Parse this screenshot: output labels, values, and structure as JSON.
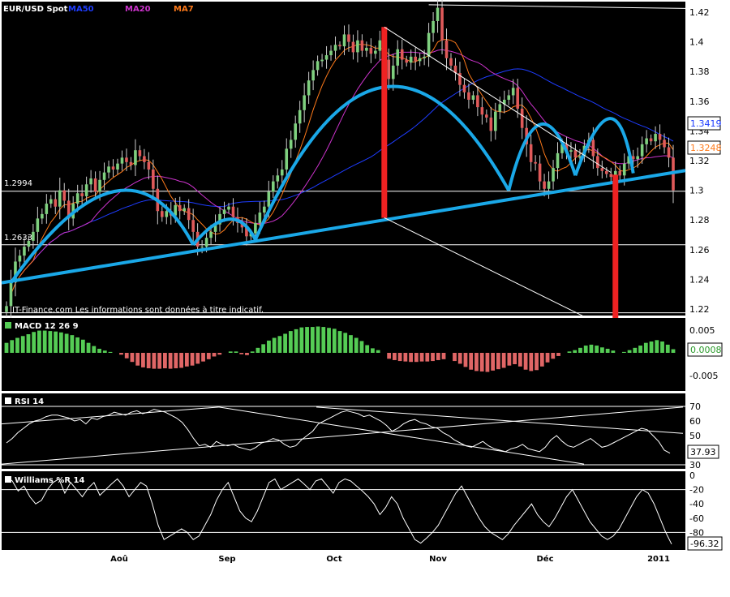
{
  "main_panel": {
    "legend": {
      "symbol": "EUR/USD Spot",
      "ma50": "MA50",
      "ma20": "MA20",
      "ma7": "MA7"
    },
    "disclaimer": "IT-Finance.com Les informations sont données à titre indicatif.",
    "level_labels": [
      "1.2994",
      "1.2633"
    ],
    "last_values": {
      "ma50": "1.3419",
      "ma7": "1.3248"
    }
  },
  "macd_panel": {
    "title": "MACD 12 26 9",
    "last_value": "0.0008"
  },
  "rsi_panel": {
    "title": "RSI 14",
    "last_value": "37.93"
  },
  "williams_panel": {
    "title": "Williams %R 14",
    "last_value": "-96.32"
  },
  "colors": {
    "background": "#000000",
    "bull_candle": "#7fd07f",
    "bear_candle": "#e05a5a",
    "ma50": "#1e3cff",
    "ma20": "#cc33cc",
    "ma7": "#ff7a1a",
    "pattern": "#1aa8e8",
    "target": "#ee2222",
    "macd_pos": "#55cc55",
    "macd_neg": "#e06666"
  },
  "chart_data": [
    {
      "type": "candlestick",
      "title": "EUR/USD Spot",
      "series": [
        {
          "name": "MA50",
          "color": "#1e3cff"
        },
        {
          "name": "MA20",
          "color": "#cc33cc"
        },
        {
          "name": "MA7",
          "color": "#ff7a1a"
        }
      ],
      "x_ticks": [
        "Aoû",
        "Sep",
        "Oct",
        "Nov",
        "Déc",
        "2011"
      ],
      "y_ticks": [
        1.22,
        1.24,
        1.26,
        1.28,
        1.3,
        1.32,
        1.34,
        1.36,
        1.38,
        1.4,
        1.42
      ],
      "ylim": [
        1.21,
        1.425
      ],
      "close": [
        1.222,
        1.238,
        1.252,
        1.256,
        1.262,
        1.266,
        1.272,
        1.281,
        1.284,
        1.291,
        1.294,
        1.289,
        1.3,
        1.293,
        1.281,
        1.291,
        1.298,
        1.296,
        1.304,
        1.308,
        1.299,
        1.307,
        1.312,
        1.316,
        1.314,
        1.318,
        1.322,
        1.319,
        1.317,
        1.327,
        1.323,
        1.319,
        1.314,
        1.301,
        1.286,
        1.282,
        1.286,
        1.283,
        1.29,
        1.286,
        1.288,
        1.28,
        1.272,
        1.262,
        1.262,
        1.268,
        1.272,
        1.277,
        1.284,
        1.287,
        1.289,
        1.282,
        1.278,
        1.275,
        1.269,
        1.271,
        1.278,
        1.285,
        1.289,
        1.299,
        1.306,
        1.31,
        1.314,
        1.328,
        1.334,
        1.345,
        1.354,
        1.364,
        1.374,
        1.381,
        1.387,
        1.388,
        1.391,
        1.394,
        1.398,
        1.397,
        1.405,
        1.4,
        1.393,
        1.401,
        1.394,
        1.396,
        1.392,
        1.394,
        1.401,
        1.388,
        1.375,
        1.384,
        1.395,
        1.388,
        1.386,
        1.39,
        1.387,
        1.389,
        1.39,
        1.406,
        1.414,
        1.423,
        1.401,
        1.389,
        1.384,
        1.379,
        1.371,
        1.366,
        1.361,
        1.364,
        1.356,
        1.351,
        1.349,
        1.34,
        1.353,
        1.358,
        1.361,
        1.364,
        1.369,
        1.355,
        1.342,
        1.331,
        1.319,
        1.318,
        1.306,
        1.301,
        1.306,
        1.315,
        1.325,
        1.331,
        1.326,
        1.327,
        1.322,
        1.323,
        1.33,
        1.334,
        1.323,
        1.315,
        1.313,
        1.311,
        1.309,
        1.313,
        1.31,
        1.318,
        1.323,
        1.321,
        1.323,
        1.331,
        1.335,
        1.333,
        1.338,
        1.334,
        1.329,
        1.322,
        1.3
      ],
      "ma50_last": 1.3419,
      "ma7_last": 1.3248,
      "annotations": [
        "1.2994",
        "1.2633"
      ]
    },
    {
      "type": "bar",
      "title": "MACD 12 26 9",
      "y_ticks": [
        0.005,
        -0.005
      ],
      "last_value": 0.0008,
      "values": [
        0.0022,
        0.0028,
        0.0033,
        0.0037,
        0.0041,
        0.0046,
        0.0049,
        0.0049,
        0.0048,
        0.0047,
        0.0045,
        0.0042,
        0.0039,
        0.0034,
        0.0029,
        0.0022,
        0.0015,
        0.0009,
        0.0005,
        0.0002,
        0.0,
        -0.0004,
        -0.0012,
        -0.002,
        -0.0028,
        -0.0032,
        -0.0034,
        -0.0035,
        -0.0035,
        -0.0034,
        -0.0035,
        -0.0034,
        -0.0033,
        -0.003,
        -0.0028,
        -0.0024,
        -0.0019,
        -0.0014,
        -0.0008,
        -0.0004,
        0.0,
        0.0003,
        0.0003,
        -0.0003,
        -0.0005,
        0.0003,
        0.0011,
        0.0019,
        0.0027,
        0.0033,
        0.0037,
        0.0042,
        0.0048,
        0.0052,
        0.0056,
        0.0057,
        0.0057,
        0.0058,
        0.0057,
        0.0055,
        0.0053,
        0.0048,
        0.0044,
        0.0039,
        0.0033,
        0.0026,
        0.0017,
        0.001,
        0.0006,
        0.0,
        -0.0013,
        -0.0016,
        -0.0018,
        -0.0019,
        -0.002,
        -0.002,
        -0.0019,
        -0.0019,
        -0.0018,
        -0.0016,
        -0.0014,
        0.0,
        -0.0018,
        -0.0024,
        -0.0031,
        -0.0037,
        -0.004,
        -0.0041,
        -0.0042,
        -0.0039,
        -0.0036,
        -0.0033,
        -0.0028,
        -0.0025,
        -0.003,
        -0.0037,
        -0.004,
        -0.0038,
        -0.003,
        -0.0021,
        -0.0013,
        -0.0007,
        0.0,
        0.0003,
        0.0006,
        0.0011,
        0.0016,
        0.0018,
        0.0016,
        0.0012,
        0.0009,
        0.0005,
        0.0,
        0.0002,
        0.0006,
        0.0011,
        0.0016,
        0.0022,
        0.0025,
        0.0028,
        0.0025,
        0.0018,
        0.0008
      ]
    },
    {
      "type": "line",
      "title": "RSI 14",
      "y_ticks": [
        30,
        40,
        50,
        60,
        70
      ],
      "ylim": [
        30,
        72
      ],
      "last_value": 37.93,
      "values": [
        45,
        48,
        52,
        55,
        58,
        60,
        61,
        63,
        64,
        64,
        63,
        62,
        60,
        61,
        58,
        62,
        61,
        63,
        64,
        66,
        65,
        64,
        66,
        67,
        65,
        66,
        68,
        67,
        66,
        64,
        62,
        59,
        54,
        48,
        43,
        44,
        42,
        46,
        44,
        43,
        44,
        42,
        41,
        40,
        42,
        45,
        46,
        48,
        47,
        44,
        42,
        43,
        47,
        50,
        53,
        58,
        60,
        62,
        64,
        66,
        67,
        66,
        65,
        63,
        64,
        62,
        60,
        57,
        53,
        55,
        58,
        60,
        61,
        59,
        58,
        56,
        55,
        52,
        50,
        47,
        45,
        43,
        42,
        44,
        46,
        43,
        41,
        40,
        39,
        41,
        42,
        44,
        41,
        40,
        39,
        42,
        47,
        50,
        46,
        43,
        42,
        44,
        46,
        48,
        45,
        42,
        43,
        45,
        47,
        49,
        51,
        53,
        55,
        54,
        50,
        46,
        40,
        37.93
      ]
    },
    {
      "type": "line",
      "title": "Williams %R 14",
      "y_ticks": [
        0,
        -20,
        -40,
        -60,
        -80
      ],
      "ylim": [
        -100,
        2
      ],
      "last_value": -96.32,
      "values": [
        -2,
        -8,
        -22,
        -15,
        -30,
        -40,
        -35,
        -20,
        -10,
        -5,
        -25,
        -10,
        -20,
        -30,
        -18,
        -10,
        -28,
        -20,
        -12,
        -5,
        -15,
        -30,
        -20,
        -10,
        -15,
        -40,
        -70,
        -90,
        -85,
        -80,
        -75,
        -80,
        -90,
        -85,
        -70,
        -55,
        -35,
        -20,
        -10,
        -30,
        -50,
        -60,
        -65,
        -50,
        -30,
        -10,
        -5,
        -20,
        -15,
        -10,
        -5,
        -12,
        -20,
        -8,
        -5,
        -15,
        -25,
        -10,
        -5,
        -8,
        -15,
        -22,
        -30,
        -40,
        -55,
        -45,
        -30,
        -40,
        -60,
        -75,
        -90,
        -95,
        -88,
        -80,
        -70,
        -55,
        -40,
        -25,
        -15,
        -30,
        -45,
        -60,
        -72,
        -80,
        -85,
        -90,
        -82,
        -70,
        -60,
        -50,
        -40,
        -55,
        -65,
        -72,
        -60,
        -45,
        -30,
        -20,
        -35,
        -50,
        -65,
        -75,
        -85,
        -90,
        -85,
        -75,
        -60,
        -45,
        -30,
        -20,
        -25,
        -40,
        -60,
        -80,
        -96.32
      ]
    }
  ]
}
